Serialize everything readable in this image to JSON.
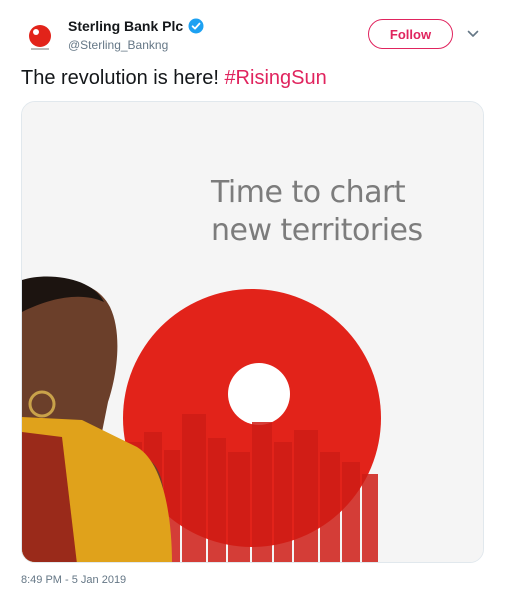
{
  "account": {
    "display_name": "Sterling Bank Plc",
    "handle": "@Sterling_Bankng",
    "verified": true,
    "brand_color": "#e2231a"
  },
  "actions": {
    "follow_label": "Follow",
    "menu_icon": "chevron-down-icon"
  },
  "tweet": {
    "text": "The revolution is here! ",
    "hashtag": "#RisingSun",
    "timestamp": "8:49 PM - 5 Jan 2019"
  },
  "media": {
    "headline_line1": "Time to chart",
    "headline_line2": "new territories",
    "accent_color": "#e2231a"
  }
}
